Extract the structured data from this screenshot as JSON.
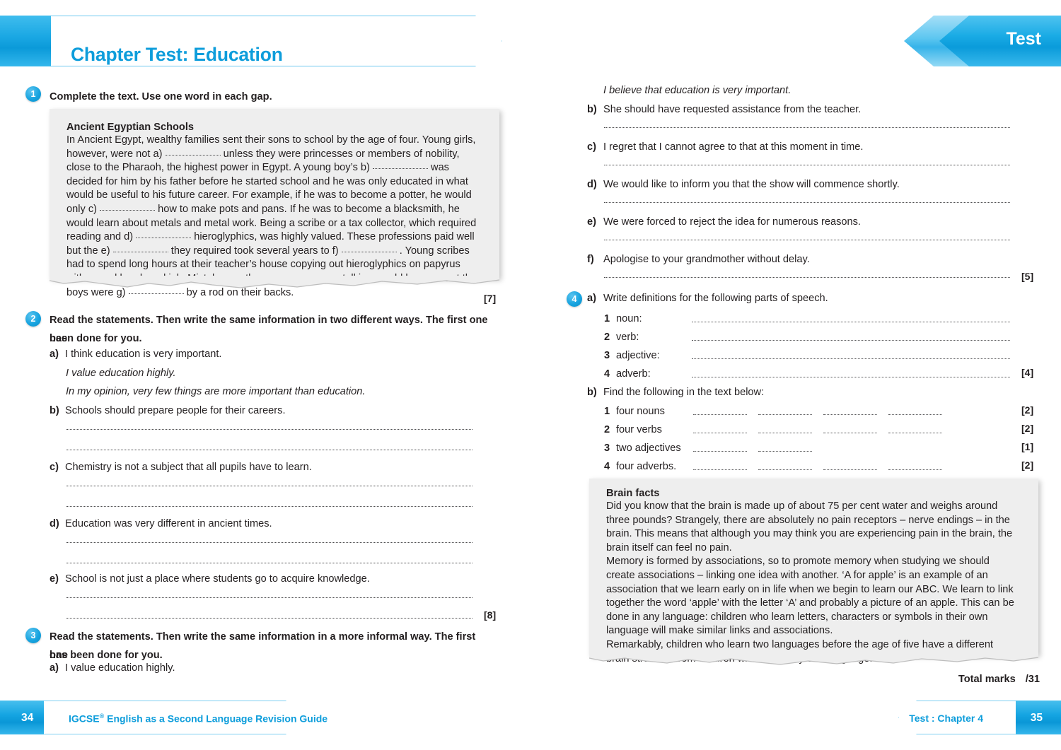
{
  "header": {
    "title": "Chapter Test: Education",
    "tab_label": "Test"
  },
  "q1": {
    "number": "1",
    "prompt": "Complete the text. Use one word in each gap.",
    "box_title": "Ancient Egyptian Schools",
    "box_text_1": "In Ancient Egypt, wealthy families sent their sons to school by the age of four. Young girls, however, were not a)",
    "box_text_2": "unless they were princesses or members of nobility, close to the Pharaoh, the highest power in Egypt. A young boy’s b)",
    "box_text_3": "was decided for him by his father before he started school and he was only educated in what would be useful to his future career. For example, if he was to become a potter, he would only c)",
    "box_text_4": "how to make pots and pans. If he was to become a blacksmith, he would learn about metals and metal work. Being a scribe or a tax collector, which required reading and d)",
    "box_text_5": "hieroglyphics, was highly valued. These professions paid well but the e)",
    "box_text_6": "they required took several years to f)",
    "box_text_7": ". Young scribes had to spend long hours at their teacher’s house copying out hieroglyphics on papyrus with a reed brush and ink. Mistakes on the papyrus, or even talking, could have meant the boys were g)",
    "box_text_8": "by a rod on their backs.",
    "marks": "[7]"
  },
  "q2": {
    "number": "2",
    "prompt_line1": "Read the statements. Then write the same information in two different ways. The first one has",
    "prompt_line2": "been done for you.",
    "items": [
      {
        "label": "a)",
        "text": "I think education is very important."
      },
      {
        "label": "b)",
        "text": "Schools should prepare people for their careers."
      },
      {
        "label": "c)",
        "text": "Chemistry is not a subject that all pupils have to learn."
      },
      {
        "label": "d)",
        "text": "Education was very different in ancient times."
      },
      {
        "label": "e)",
        "text": "School is not just a place where students go to acquire knowledge."
      }
    ],
    "example_1": "I value education highly.",
    "example_2": "In my opinion, very few things are more important than education.",
    "marks": "[8]"
  },
  "q3": {
    "number": "3",
    "prompt_line1": "Read the statements. Then write the same information in a more informal way. The first one",
    "prompt_line2": "has been done for you.",
    "items": [
      {
        "label": "a)",
        "text": "I value education highly."
      },
      {
        "label": "b)",
        "text": "She should have requested assistance from the teacher."
      },
      {
        "label": "c)",
        "text": "I regret that I cannot agree to that at this moment in time."
      },
      {
        "label": "d)",
        "text": "We would like to inform you that the show will commence shortly."
      },
      {
        "label": "e)",
        "text": "We were forced to reject the idea for numerous reasons."
      },
      {
        "label": "f)",
        "text": "Apologise to your grandmother without delay."
      }
    ],
    "example_1": "I believe that education is very important.",
    "marks": "[5]"
  },
  "q4": {
    "number": "4",
    "part_a_label": "a)",
    "part_a_prompt": "Write definitions for the following parts of speech.",
    "part_a_items": [
      {
        "num": "1",
        "text": "noun:"
      },
      {
        "num": "2",
        "text": "verb:"
      },
      {
        "num": "3",
        "text": "adjective:"
      },
      {
        "num": "4",
        "text": "adverb:"
      }
    ],
    "part_a_marks": "[4]",
    "part_b_label": "b)",
    "part_b_prompt": "Find the following in the text below:",
    "part_b_items": [
      {
        "num": "1",
        "text": "four nouns",
        "blanks": 4,
        "marks": "[2]"
      },
      {
        "num": "2",
        "text": "four verbs",
        "blanks": 4,
        "marks": "[2]"
      },
      {
        "num": "3",
        "text": "two adjectives",
        "blanks": 2,
        "marks": "[1]"
      },
      {
        "num": "4",
        "text": "four adverbs.",
        "blanks": 4,
        "marks": "[2]"
      }
    ],
    "box_title": "Brain facts",
    "box_para_1": "Did you know that the brain is made up of about 75 per cent water and weighs around three pounds? Strangely, there are absolutely no pain receptors – nerve endings – in the brain. This means that although you may think you are experiencing pain in the brain, the brain itself can feel no pain.",
    "box_para_2": "Memory is formed by associations, so to promote memory when studying we should create associations – linking one idea with another. ‘A for apple’ is an example of an association that we learn early on in life when we begin to learn our ABC. We learn to link together the word ‘apple’ with the letter ‘A’ and probably a picture of an apple. This can be done in any language: children who learn letters, characters or symbols in their own language will make similar links and associations.",
    "box_para_3": "Remarkably, children who learn two languages before the age of five have a different brain structure from children who learn only one language."
  },
  "footer": {
    "total_marks_label": "Total marks",
    "total_marks_value": "/31",
    "left_page_number": "34",
    "left_text": "IGCSE",
    "left_text_sup": "®",
    "left_text_rest": " English as a Second Language Revision Guide",
    "right_text": "Test : Chapter 4",
    "right_page_number": "35"
  },
  "colors": {
    "brand_blue": "#0d9ddb",
    "light_blue": "#4fc3f0",
    "ink": "#231f20",
    "box_grey": "#eeeeee"
  }
}
